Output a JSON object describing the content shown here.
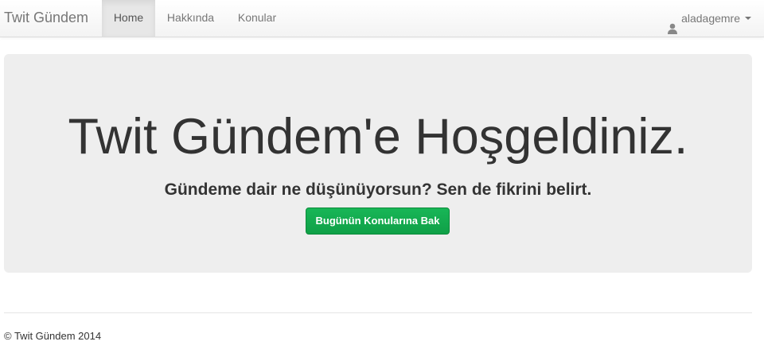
{
  "navbar": {
    "brand": "Twit Gündem",
    "items": [
      {
        "label": "Home",
        "active": true
      },
      {
        "label": "Hakkında",
        "active": false
      },
      {
        "label": "Konular",
        "active": false
      }
    ],
    "user": {
      "icon": "user-icon",
      "name": "aladagemre",
      "dropdown_icon": "caret-down-icon"
    }
  },
  "jumbotron": {
    "title": "Twit Gündem'e Hoşgeldiniz.",
    "subtitle": "Gündeme dair ne düşünüyorsun? Sen de fikrini belirt.",
    "button_label": "Bugünün Konularına Bak",
    "button_color": "#18b657"
  },
  "footer": {
    "text": "© Twit Gündem 2014"
  },
  "colors": {
    "navbar_bg": "#f8f8f8",
    "active_tab_bg": "#e7e7e7",
    "jumbotron_bg": "#eeeeee",
    "text": "#333333",
    "nav_text": "#777777"
  }
}
